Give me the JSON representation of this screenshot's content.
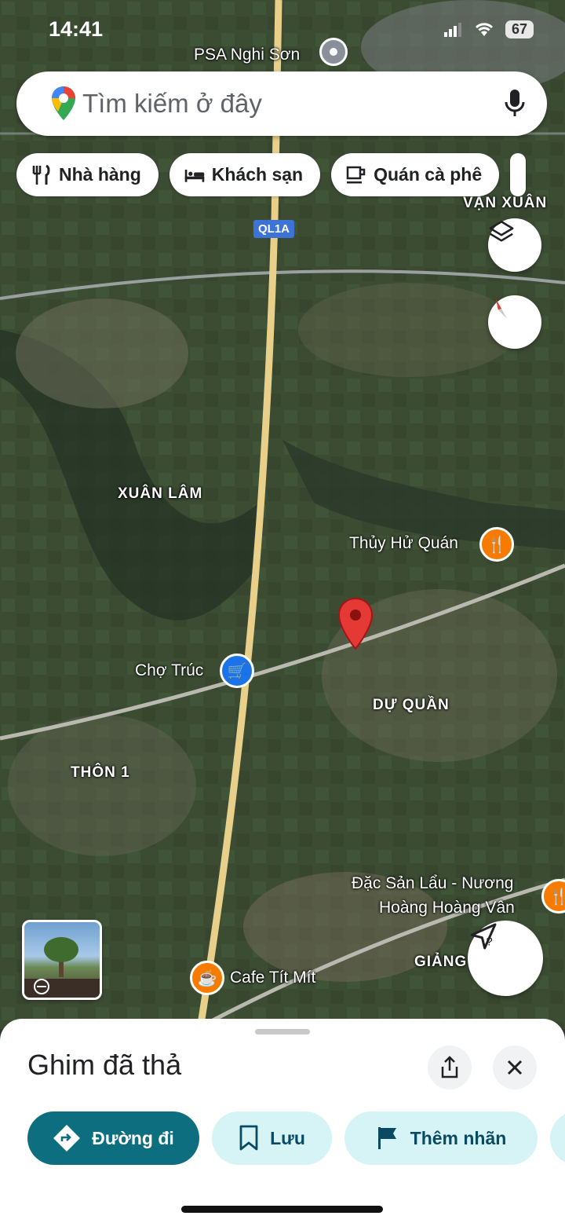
{
  "status_bar": {
    "time": "14:41",
    "battery": "67"
  },
  "search": {
    "placeholder": "Tìm kiếm ở đây"
  },
  "categories": [
    {
      "label": "Nhà hàng",
      "icon": "restaurant-icon"
    },
    {
      "label": "Khách sạn",
      "icon": "hotel-icon"
    },
    {
      "label": "Quán cà phê",
      "icon": "coffee-icon"
    }
  ],
  "map": {
    "road_shield": "QL1A",
    "labels": {
      "psa": "PSA Nghi Sơn",
      "van_xuan": "VẠN XUÂN",
      "xuan_lam": "XUÂN LÂM",
      "thuy_hu": "Thủy Hử Quán",
      "cho_truc": "Chợ Trúc",
      "du_quan": "DỰ QUẦN",
      "thon1": "THÔN 1",
      "dac_san_1": "Đặc Sản Lẩu - Nương",
      "dac_san_2": "Hoàng Hoàng Vân",
      "giang": "GIẢNG",
      "cafe": "Cafe Tít Mít"
    }
  },
  "sheet": {
    "title": "Ghim đã thả",
    "actions": {
      "directions": "Đường đi",
      "save": "Lưu",
      "label": "Thêm nhãn"
    }
  },
  "colors": {
    "accent": "#0d6e7f",
    "action_bg": "#d6f3f5",
    "pin": "#e53935",
    "poi_food": "#f57c00",
    "poi_shop": "#1a73e8"
  }
}
